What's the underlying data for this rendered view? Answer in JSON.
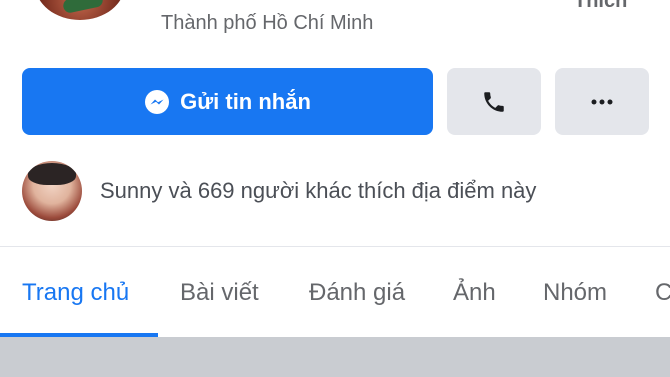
{
  "header": {
    "location": "Thành phố Hồ Chí Minh",
    "like_label_partial": "Thích"
  },
  "actions": {
    "message_label": "Gửi tin nhắn"
  },
  "friends": {
    "text": "Sunny và 669 người khác thích địa điểm này"
  },
  "tabs": [
    {
      "label": "Trang chủ",
      "active": true
    },
    {
      "label": "Bài viết",
      "active": false
    },
    {
      "label": "Đánh giá",
      "active": false
    },
    {
      "label": "Ảnh",
      "active": false
    },
    {
      "label": "Nhóm",
      "active": false
    },
    {
      "label": "C",
      "active": false
    }
  ],
  "colors": {
    "accent": "#1877f2",
    "button_gray": "#e4e6eb",
    "muted_text": "#65676b"
  }
}
